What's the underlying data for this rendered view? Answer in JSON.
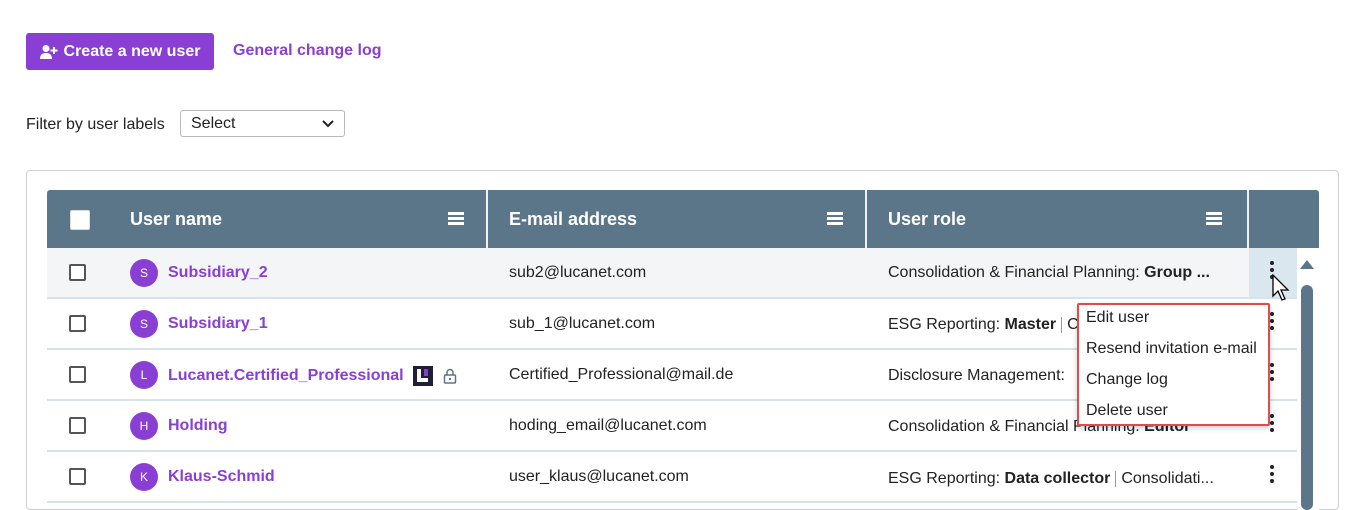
{
  "toolbar": {
    "create_label": "Create a new user",
    "change_log_label": "General change log"
  },
  "filter": {
    "label": "Filter by user labels",
    "value": "Select"
  },
  "table": {
    "columns": [
      "User name",
      "E-mail address",
      "User role"
    ],
    "rows": [
      {
        "initial": "S",
        "name": "Subsidiary_2",
        "email": "sub2@lucanet.com",
        "role_a": "Consolidation & Financial Planning:",
        "role_b": "Group ...",
        "role_c": "",
        "role_d": ""
      },
      {
        "initial": "S",
        "name": "Subsidiary_1",
        "email": "sub_1@lucanet.com",
        "role_a": "ESG Reporting:",
        "role_b": "Master",
        "role_c": "C",
        "role_d": ""
      },
      {
        "initial": "L",
        "name": "Lucanet.Certified_Professional",
        "email": "Certified_Professional@mail.de",
        "role_a": "Disclosure Management:",
        "role_b": "",
        "role_c": "",
        "role_d": ""
      },
      {
        "initial": "H",
        "name": "Holding",
        "email": "hoding_email@lucanet.com",
        "role_a": "Consolidation & Financial Planning:",
        "role_b": "Editor",
        "role_c": "",
        "role_d": ""
      },
      {
        "initial": "K",
        "name": "Klaus-Schmid",
        "email": "user_klaus@lucanet.com",
        "role_a": "ESG Reporting:",
        "role_b": "Data collector",
        "role_c": "Consolidati...",
        "role_d": ""
      }
    ]
  },
  "context_menu": {
    "items": [
      "Edit user",
      "Resend invitation e-mail",
      "Change log",
      "Delete user"
    ]
  },
  "colors": {
    "accent": "#8a3fd4",
    "header": "#5a7688",
    "highlight_border": "#e04b4b"
  }
}
